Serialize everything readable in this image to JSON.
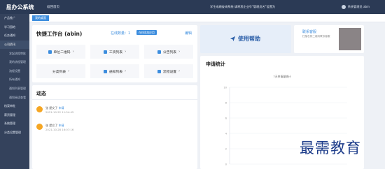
{
  "header": {
    "brand": "易办公系统",
    "home_link": "返回首页",
    "notice": "学生成绩查询系统 请将您企业号\"管理员名\"设置为 ",
    "user": "系统管理员 abin"
  },
  "sidebar": {
    "items": [
      {
        "label": "产品推广"
      },
      {
        "label": "学习园地"
      },
      {
        "label": "任务通知"
      },
      {
        "label": "公司资讯"
      },
      {
        "label": "发起流程审批"
      },
      {
        "label": "我的流程管理"
      },
      {
        "label": "流程设置"
      },
      {
        "label": "所有通知"
      },
      {
        "label": "通知列表管理"
      },
      {
        "label": "通知阅读查看"
      },
      {
        "label": "档案审批"
      },
      {
        "label": "薪资管理"
      },
      {
        "label": "系统管理"
      },
      {
        "label": "分类设置管理"
      }
    ]
  },
  "tabs": [
    {
      "label": "我的桌面"
    }
  ],
  "workbench": {
    "title": "快捷工作台 (abin)",
    "online_label": "在线数量：1",
    "badge": "在线添加应用",
    "edit": "编辑",
    "items": [
      {
        "label": "单位二维码"
      },
      {
        "label": "工资列表"
      },
      {
        "label": "公告列表"
      },
      {
        "label": "分类列表"
      },
      {
        "label": "通知列表"
      },
      {
        "label": "流程设置"
      }
    ],
    "arrow": "›"
  },
  "dynamic": {
    "title": "动态",
    "rows": [
      {
        "actor": "张 提交了",
        "link": "申请",
        "time": "2021-10-22 11:54:45"
      },
      {
        "actor": "张 提交了",
        "link": "申请",
        "time": "2021-10-28 16:07:16"
      }
    ]
  },
  "help": {
    "label": "使用帮助"
  },
  "contact": {
    "title": "联系客服",
    "desc": "扫描右侧二维码联系客服"
  },
  "stats": {
    "title": "申请统计",
    "chart_title": "7天申请量统计"
  },
  "chart_data": {
    "type": "line",
    "title": "7天申请量统计",
    "ylim": [
      0,
      10
    ],
    "yticks": [
      "10",
      "8",
      "6",
      "4",
      "2",
      "0"
    ],
    "grid": true,
    "series": []
  },
  "watermark": "最需教育",
  "colors": {
    "topbar": "#2b3a55",
    "sidebar": "#34425c",
    "accent": "#3c8dde",
    "avatar": "#f5a623"
  }
}
